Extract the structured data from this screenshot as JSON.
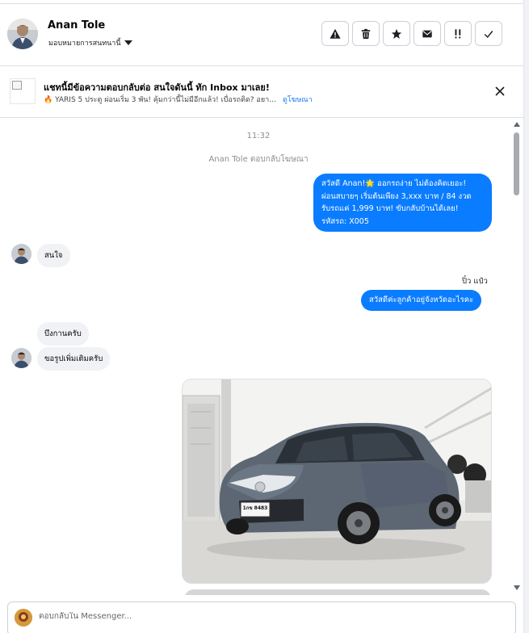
{
  "contact": {
    "name": "Anan Tole",
    "assign_label": "มอบหมายการสนทนานี้"
  },
  "actions": [
    {
      "icon": "warning-icon",
      "name": "spam-button"
    },
    {
      "icon": "trash-icon",
      "name": "delete-button"
    },
    {
      "icon": "star-icon",
      "name": "star-button"
    },
    {
      "icon": "envelope-icon",
      "name": "mark-unread-button"
    },
    {
      "icon": "priority-icon",
      "name": "follow-up-button"
    },
    {
      "icon": "check-icon",
      "name": "done-button"
    }
  ],
  "banner": {
    "title": "แชทนี้มีข้อความตอบกลับต่อ สนใจดันนี้ ทัก Inbox มาเลย!",
    "emoji": "🔥",
    "subtitle": "YARIS 5 ประตู ผ่อนเริ่ม 3 พัน! คุ้มกว่านี้ไม่มีอีกแล้ว! เบื่อรถติด? อยากไ...",
    "link": "ดูโฆษณา"
  },
  "chat": {
    "time": "11:32",
    "replied_to_ad": "Anan Tole ตอบกลับโฆษณา",
    "outgoing_1": [
      "สวัสดี Anan!🌟 ออกรถง่าย ไม่ต้องคิดเยอะ!",
      "ผ่อนสบายๆ เริ่มต้นเพียง 3,xxx บาท / 84 งวด",
      "รับรถแค่ 1,999 บาท! ขับกลับบ้านได้เลย!",
      "รหัสรถ: X005"
    ],
    "incoming_1": "สนใจ",
    "agent_name": "ปิ๋ว แป๋ว",
    "outgoing_2": "สวัสดีค่ะลูกค้าอยู่จังหวัดอะไรคะ",
    "incoming_2": "บึงกานครับ",
    "incoming_3": "ขอรูปเพิ่มเติมครับ",
    "photo_plate": "1กข 8483"
  },
  "composer": {
    "placeholder": "ตอบกลับใน Messenger..."
  },
  "colors": {
    "accent": "#0a7cff",
    "incoming_bg": "#f0f2f5"
  }
}
